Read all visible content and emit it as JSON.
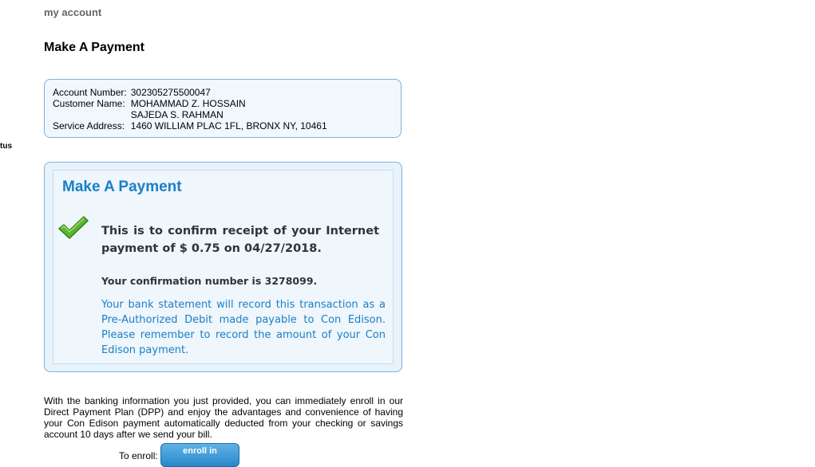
{
  "sidebar": {
    "partial_label": "tus"
  },
  "header": {
    "breadcrumb": "my account",
    "title": "Make A Payment"
  },
  "account": {
    "number_label": "Account Number:",
    "number": "302305275500047",
    "customer_label": "Customer Name:",
    "customer_name_1": "MOHAMMAD Z. HOSSAIN",
    "customer_name_2": "SAJEDA S. RAHMAN",
    "address_label": "Service Address:",
    "address": "1460 WILLIAM PLAC 1FL, BRONX NY, 10461"
  },
  "confirmation": {
    "heading": "Make A Payment",
    "icon": "checkmark-icon",
    "message": "This is to confirm receipt of your Internet payment of $ 0.75 on 04/27/2018.",
    "confirmation_number_text": "Your confirmation number is 3278099.",
    "bank_note": "Your bank statement will record this transaction as a Pre-Authorized Debit made payable to Con Edison. Please remember to record the amount of your Con Edison payment."
  },
  "dpp": {
    "text": "With the banking information you just provided, you can immediately enroll in our Direct Payment Plan (DPP) and enjoy the advantages and convenience of having your Con Edison payment automatically deducted from your checking or savings account 10 days after we send your bill.",
    "enroll_label": "To enroll:",
    "enroll_button": "enroll in"
  },
  "colors": {
    "accent": "#1a7fc6",
    "box_border": "#7fb2dc",
    "box_bg": "#e8f2fb",
    "check_green": "#5cb82e"
  }
}
